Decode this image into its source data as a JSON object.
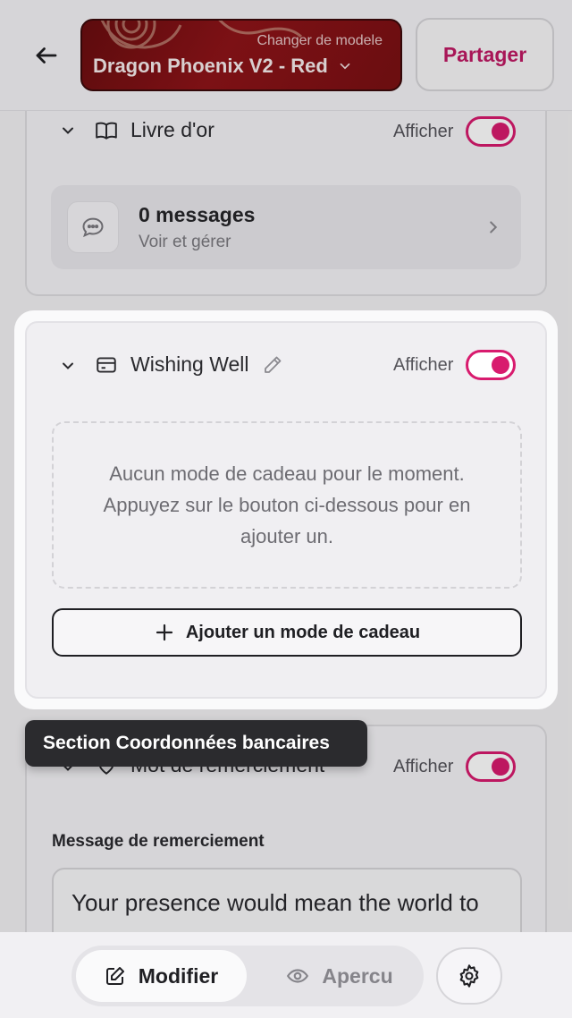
{
  "header": {
    "template_change_label": "Changer de modele",
    "template_name": "Dragon Phoenix V2 - Red",
    "share_label": "Partager"
  },
  "guestbook": {
    "title": "Livre d'or",
    "toggle_label": "Afficher",
    "messages_count": "0 messages",
    "messages_sub": "Voir et gérer"
  },
  "wishing_well": {
    "title": "Wishing Well",
    "toggle_label": "Afficher",
    "empty_text": "Aucun mode de cadeau pour le moment. Appuyez sur le bouton ci-dessous pour en ajouter un.",
    "add_button_label": "Ajouter un mode de cadeau"
  },
  "thanks": {
    "title": "Mot de remerciement",
    "toggle_label": "Afficher",
    "field_label": "Message de remerciement",
    "field_value": "Your presence would mean the world to us"
  },
  "tooltip": {
    "text": "Section Coordonnées bancaires"
  },
  "bottom_nav": {
    "edit_label": "Modifier",
    "preview_label": "Apercu"
  },
  "colors": {
    "accent": "#d81b6e",
    "share_text": "#c01a63",
    "template_bg": "#8e1418"
  }
}
